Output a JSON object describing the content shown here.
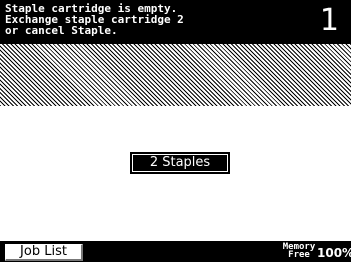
{
  "header": {
    "message_lines": [
      "Staple cartridge is empty.",
      "Exchange staple cartridge 2",
      "or cancel Staple."
    ],
    "page_number": "1"
  },
  "main": {
    "staples_button_label": "2 Staples"
  },
  "footer": {
    "job_list_label": "Job List",
    "memory_label_top": "Memory",
    "memory_label_bottom": "Free",
    "memory_value": "100%"
  }
}
